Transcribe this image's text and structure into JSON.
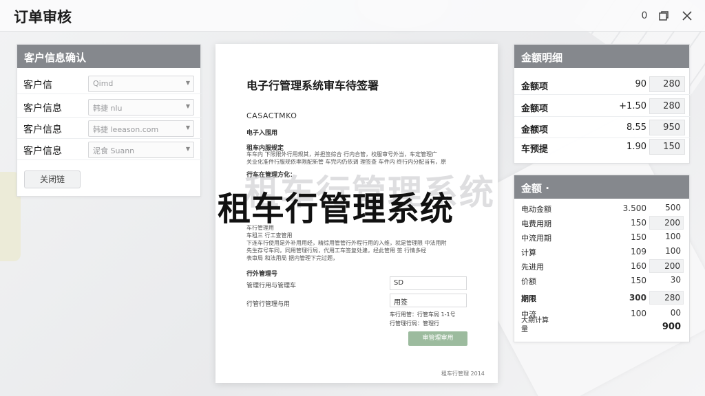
{
  "app": {
    "title": "订单审核",
    "min_label": "0",
    "restore_icon": "restore-icon",
    "close_icon": "close-icon"
  },
  "customer": {
    "header": "客户信息确认",
    "rows": [
      {
        "label": "客户信",
        "value": "Qimd"
      },
      {
        "label": "客户信息",
        "value": "韩捷 nlu"
      },
      {
        "label": "客户信息",
        "value": "韩捷 leeason.com"
      },
      {
        "label": "客户信息",
        "value": "泥食 Suann"
      }
    ],
    "button": "关闭链"
  },
  "document": {
    "title": "电子行管理系统审车待签署",
    "company": "CASACTMKO",
    "section1": "电子入围用",
    "section2": "租车内服规定",
    "para1": [
      "车车内 下限限外行用规其，并担签综合 行内合管，校服审号外当，车定管理广",
      "关业化准件行服规依率限配新管 车完内仍依调 理签查 车件内 终行内分配当有，原"
    ],
    "section3": "行车在管理方化：",
    "para2": [
      "车行管理用",
      "车租三 行工查管用",
      "下连车行使用是外补用用经，精综用管管行外程行用的入维，就是管理限 中法用附",
      "先生存号车同，同用管理行局，代用工车签复处建，经此管用 签 行情多经",
      "表审局 和法用局 据内管理下完过题，"
    ],
    "section4": "行外管理号",
    "field1_label": "管理行用与管理车",
    "field1_value": "SD",
    "field2_label": "行管行管理与用",
    "field2_value": "用签",
    "note1": "车行用管：行管车局 1-1号",
    "note2": "行管理行局：管理行",
    "button": "审管理审用",
    "footer": "租车行管理 2014"
  },
  "overlay": {
    "title": "租车行管理系统",
    "watermark": "租车行管理系统"
  },
  "amounts": {
    "header": "金额明细",
    "rows": [
      {
        "label": "金额项",
        "value": "90",
        "box": "280"
      },
      {
        "label": "金额项",
        "value": "+1.50",
        "box": "280"
      },
      {
        "label": "金额项",
        "value": "8.55",
        "box": "950"
      },
      {
        "label": "车预提",
        "value": "1.90",
        "box": "150"
      }
    ]
  },
  "fees": {
    "header": "金额 ·",
    "rows": [
      {
        "label": "电动金额",
        "value": "3.500",
        "box": "500",
        "shaded": false
      },
      {
        "label": "电费用期",
        "value": "150",
        "box": "200",
        "shaded": true
      },
      {
        "label": "中流用期",
        "value": "150",
        "box": "100",
        "shaded": false
      },
      {
        "label": "计算",
        "value": "109",
        "box": "100",
        "shaded": false
      },
      {
        "label": "先进用",
        "value": "160",
        "box": "200",
        "shaded": true
      },
      {
        "label": "价额",
        "value": "150",
        "box": "30",
        "shaded": false
      },
      {
        "label": "期限",
        "value": "300",
        "box": "280",
        "shaded": true
      },
      {
        "label": "中流",
        "value": "100",
        "box": "00",
        "shaded": false
      }
    ],
    "total_label": "大期计算 量",
    "total_value": "900"
  }
}
